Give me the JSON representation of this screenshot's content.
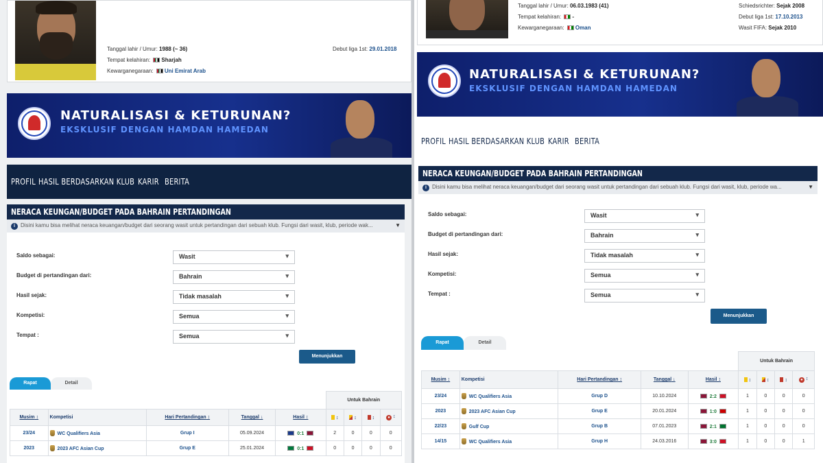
{
  "colors": {
    "nav_bg": "#0f2341",
    "header_bg": "#13284a",
    "banner_bg": "#17308d",
    "link": "#1a4f8b",
    "tab_active": "#1a9ad6",
    "button": "#1b5a8a"
  },
  "left": {
    "profile": {
      "birth_label": "Tanggal lahir / Umur:",
      "birth_value": "1988 (~ 36)",
      "place_label": "Tempat kelahiran:",
      "place_value": "Sharjah",
      "nationality_label": "Kewarganegaraan:",
      "nationality_value": "Uni Emirat Arab",
      "debut_label": "Debut liga 1st:",
      "debut_value": "29.01.2018"
    },
    "banner": {
      "title": "NATURALISASI & KETURUNAN?",
      "subtitle": "EKSKLUSIF DENGAN HAMDAN HAMEDAN"
    },
    "nav": [
      "PROFIL",
      "HASIL BERDASARKAN KLUB",
      "KARIR",
      "BERITA"
    ],
    "box": {
      "header": "NERACA KEUNGAN/BUDGET PADA BAHRAIN PERTANDINGAN",
      "description": "Disini kamu bisa melihat neraca keuangan/budget dari seorang wasit untuk pertandingan dari sebuah klub. Fungsi dari wasit, klub, periode wak...",
      "filters": [
        {
          "label": "Saldo sebagai:",
          "value": "Wasit"
        },
        {
          "label": "Budget di pertandingan dari:",
          "value": "Bahrain"
        },
        {
          "label": "Hasil sejak:",
          "value": "Tidak masalah"
        },
        {
          "label": "Kompetisi:",
          "value": "Semua"
        },
        {
          "label": "Tempat :",
          "value": "Semua"
        }
      ],
      "button": "Menunjukkan",
      "tabs": [
        "Rapat",
        "Detail"
      ],
      "group_header": "Untuk Bahrain",
      "columns": [
        "Musim",
        "Kompetisi",
        "Hari Pertandingan",
        "Tanggal",
        "Hasil"
      ],
      "rows": [
        {
          "season": "23/24",
          "competition": "WC Qualifiers Asia",
          "matchday": "Grup I",
          "date": "05.09.2024",
          "score": "0:1",
          "home_flag": "#1a3a8a",
          "away_flag": "#8a1538",
          "c1": "2",
          "c2": "0",
          "c3": "0",
          "c4": "0"
        },
        {
          "season": "2023",
          "competition": "2023 AFC Asian Cup",
          "matchday": "Grup E",
          "date": "25.01.2024",
          "score": "0:1",
          "home_flag": "#007a3d",
          "away_flag": "#ce1126",
          "c1": "0",
          "c2": "0",
          "c3": "0",
          "c4": "0"
        }
      ]
    }
  },
  "right": {
    "profile": {
      "birth_label": "Tanggal lahir / Umur:",
      "birth_value": "06.03.1983 (41)",
      "place_label": "Tempat kelahiran:",
      "place_value": "-",
      "nationality_label": "Kewarganegaraan:",
      "nationality_value": "Oman",
      "referee_label": "Schiedsrichter:",
      "referee_value": "Sejak 2008",
      "debut_label": "Debut liga 1st:",
      "debut_value": "17.10.2013",
      "fifa_label": "Wasit FIFA:",
      "fifa_value": "Sejak 2010"
    },
    "banner": {
      "title": "NATURALISASI & KETURUNAN?",
      "subtitle": "EKSKLUSIF DENGAN HAMDAN HAMEDAN"
    },
    "nav": [
      "PROFIL",
      "HASIL BERDASARKAN KLUB",
      "KARIR",
      "BERITA"
    ],
    "box": {
      "header": "NERACA KEUNGAN/BUDGET PADA BAHRAIN PERTANDINGAN",
      "description": "Disini kamu bisa melihat neraca keuangan/budget dari seorang wasit untuk pertandingan dari sebuah klub. Fungsi dari wasit, klub, periode wa...",
      "filters": [
        {
          "label": "Saldo sebagai:",
          "value": "Wasit"
        },
        {
          "label": "Budget di pertandingan dari:",
          "value": "Bahrain"
        },
        {
          "label": "Hasil sejak:",
          "value": "Tidak masalah"
        },
        {
          "label": "Kompetisi:",
          "value": "Semua"
        },
        {
          "label": "Tempat :",
          "value": "Semua"
        }
      ],
      "button": "Menunjukkan",
      "tabs": [
        "Rapat",
        "Detail"
      ],
      "group_header": "Untuk Bahrain",
      "columns": [
        "Musim",
        "Kompetisi",
        "Hari Pertandingan",
        "Tanggal",
        "Hasil"
      ],
      "rows": [
        {
          "season": "23/24",
          "competition": "WC Qualifiers Asia",
          "matchday": "Grup D",
          "date": "10.10.2024",
          "score": "2:2",
          "home_flag": "#8a1538",
          "away_flag": "#ce1126",
          "c1": "1",
          "c2": "0",
          "c3": "0",
          "c4": "0"
        },
        {
          "season": "2023",
          "competition": "2023 AFC Asian Cup",
          "matchday": "Grup E",
          "date": "20.01.2024",
          "score": "1:0",
          "home_flag": "#8a1538",
          "away_flag": "#cc0001",
          "c1": "1",
          "c2": "0",
          "c3": "0",
          "c4": "0"
        },
        {
          "season": "22/23",
          "competition": "Gulf Cup",
          "matchday": "Grup B",
          "date": "07.01.2023",
          "score": "2:1",
          "home_flag": "#8a1538",
          "away_flag": "#00732f",
          "c1": "1",
          "c2": "0",
          "c3": "0",
          "c4": "0"
        },
        {
          "season": "14/15",
          "competition": "WC Qualifiers Asia",
          "matchday": "Grup H",
          "date": "24.03.2016",
          "score": "3:0",
          "home_flag": "#8a1538",
          "away_flag": "#ce1126",
          "c1": "1",
          "c2": "0",
          "c3": "0",
          "c4": "1"
        }
      ]
    }
  }
}
